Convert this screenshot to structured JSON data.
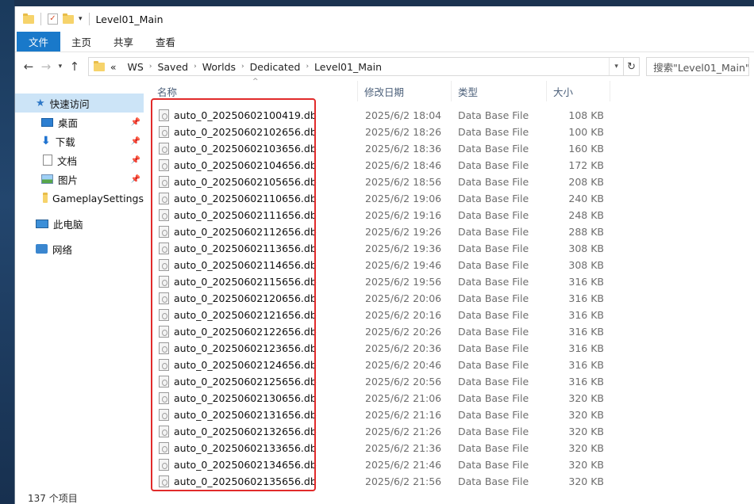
{
  "window": {
    "title": "Level01_Main"
  },
  "ribbon": {
    "tabs": [
      "文件",
      "主页",
      "共享",
      "查看"
    ]
  },
  "address": {
    "crumbs": [
      "WS",
      "Saved",
      "Worlds",
      "Dedicated",
      "Level01_Main"
    ],
    "search_placeholder": "搜索\"Level01_Main\""
  },
  "sidebar": {
    "quick_access": "快速访问",
    "items": [
      {
        "label": "桌面",
        "icon": "desktop-icon",
        "pinned": true
      },
      {
        "label": "下载",
        "icon": "download-icon",
        "pinned": true
      },
      {
        "label": "文档",
        "icon": "document-icon",
        "pinned": true
      },
      {
        "label": "图片",
        "icon": "pictures-icon",
        "pinned": true
      },
      {
        "label": "GameplaySettings",
        "icon": "folder-icon",
        "pinned": false
      }
    ],
    "this_pc": "此电脑",
    "network": "网络"
  },
  "columns": {
    "name": "名称",
    "date": "修改日期",
    "type": "类型",
    "size": "大小"
  },
  "files": [
    {
      "name": "auto_0_20250602100419.db",
      "date": "2025/6/2 18:04",
      "type": "Data Base File",
      "size": "108 KB"
    },
    {
      "name": "auto_0_20250602102656.db",
      "date": "2025/6/2 18:26",
      "type": "Data Base File",
      "size": "100 KB"
    },
    {
      "name": "auto_0_20250602103656.db",
      "date": "2025/6/2 18:36",
      "type": "Data Base File",
      "size": "160 KB"
    },
    {
      "name": "auto_0_20250602104656.db",
      "date": "2025/6/2 18:46",
      "type": "Data Base File",
      "size": "172 KB"
    },
    {
      "name": "auto_0_20250602105656.db",
      "date": "2025/6/2 18:56",
      "type": "Data Base File",
      "size": "208 KB"
    },
    {
      "name": "auto_0_20250602110656.db",
      "date": "2025/6/2 19:06",
      "type": "Data Base File",
      "size": "240 KB"
    },
    {
      "name": "auto_0_20250602111656.db",
      "date": "2025/6/2 19:16",
      "type": "Data Base File",
      "size": "248 KB"
    },
    {
      "name": "auto_0_20250602112656.db",
      "date": "2025/6/2 19:26",
      "type": "Data Base File",
      "size": "288 KB"
    },
    {
      "name": "auto_0_20250602113656.db",
      "date": "2025/6/2 19:36",
      "type": "Data Base File",
      "size": "308 KB"
    },
    {
      "name": "auto_0_20250602114656.db",
      "date": "2025/6/2 19:46",
      "type": "Data Base File",
      "size": "308 KB"
    },
    {
      "name": "auto_0_20250602115656.db",
      "date": "2025/6/2 19:56",
      "type": "Data Base File",
      "size": "316 KB"
    },
    {
      "name": "auto_0_20250602120656.db",
      "date": "2025/6/2 20:06",
      "type": "Data Base File",
      "size": "316 KB"
    },
    {
      "name": "auto_0_20250602121656.db",
      "date": "2025/6/2 20:16",
      "type": "Data Base File",
      "size": "316 KB"
    },
    {
      "name": "auto_0_20250602122656.db",
      "date": "2025/6/2 20:26",
      "type": "Data Base File",
      "size": "316 KB"
    },
    {
      "name": "auto_0_20250602123656.db",
      "date": "2025/6/2 20:36",
      "type": "Data Base File",
      "size": "316 KB"
    },
    {
      "name": "auto_0_20250602124656.db",
      "date": "2025/6/2 20:46",
      "type": "Data Base File",
      "size": "316 KB"
    },
    {
      "name": "auto_0_20250602125656.db",
      "date": "2025/6/2 20:56",
      "type": "Data Base File",
      "size": "316 KB"
    },
    {
      "name": "auto_0_20250602130656.db",
      "date": "2025/6/2 21:06",
      "type": "Data Base File",
      "size": "320 KB"
    },
    {
      "name": "auto_0_20250602131656.db",
      "date": "2025/6/2 21:16",
      "type": "Data Base File",
      "size": "320 KB"
    },
    {
      "name": "auto_0_20250602132656.db",
      "date": "2025/6/2 21:26",
      "type": "Data Base File",
      "size": "320 KB"
    },
    {
      "name": "auto_0_20250602133656.db",
      "date": "2025/6/2 21:36",
      "type": "Data Base File",
      "size": "320 KB"
    },
    {
      "name": "auto_0_20250602134656.db",
      "date": "2025/6/2 21:46",
      "type": "Data Base File",
      "size": "320 KB"
    },
    {
      "name": "auto_0_20250602135656.db",
      "date": "2025/6/2 21:56",
      "type": "Data Base File",
      "size": "320 KB"
    }
  ],
  "status": {
    "count_text": "137 个项目"
  },
  "colors": {
    "file_tab": "#1979ca",
    "selection": "#cce4f7",
    "highlight_box": "#e12b2b"
  }
}
